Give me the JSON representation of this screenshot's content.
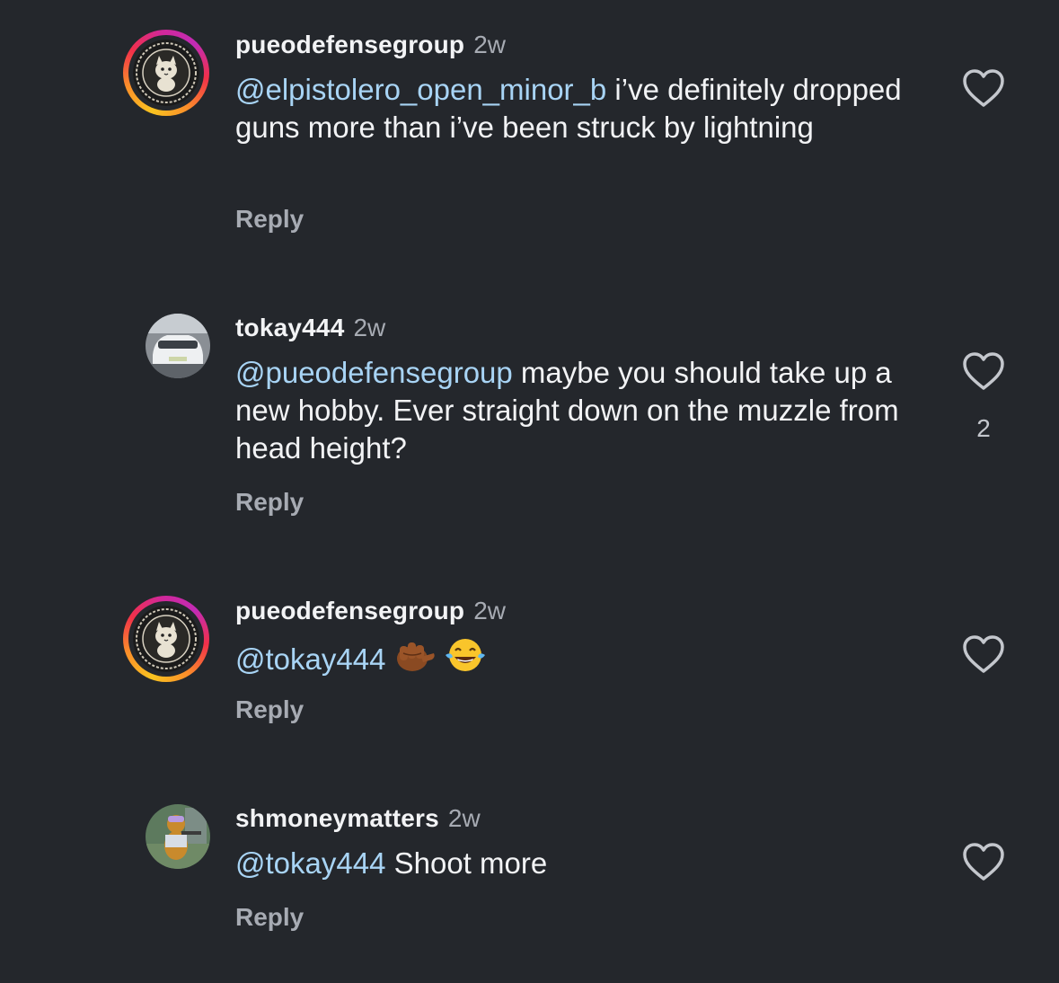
{
  "comments": [
    {
      "username": "pueodefensegroup",
      "time": "2w",
      "mention": "@elpistolero_open_minor_b",
      "text": " i’ve definitely dropped guns more than i’ve been struck by lightning",
      "reply_label": "Reply",
      "like_count": ""
    },
    {
      "username": "tokay444",
      "time": "2w",
      "mention": "@pueodefensegroup",
      "text": " maybe you should take up a new hobby. Ever straight down on the muzzle from head height?",
      "reply_label": "Reply",
      "like_count": "2"
    },
    {
      "username": "pueodefensegroup",
      "time": "2w",
      "mention": "@tokay444",
      "text": "",
      "emojis": [
        "pointing-fist-emoji",
        "tears-of-joy-emoji"
      ],
      "reply_label": "Reply",
      "like_count": ""
    },
    {
      "username": "shmoneymatters",
      "time": "2w",
      "mention": "@tokay444",
      "text": " Shoot more",
      "reply_label": "Reply",
      "like_count": ""
    }
  ],
  "icons": {
    "like": "heart-outline-icon"
  },
  "colors": {
    "background": "#24272c",
    "mention": "#a8d4f5",
    "secondary_text": "#a7abb3"
  }
}
